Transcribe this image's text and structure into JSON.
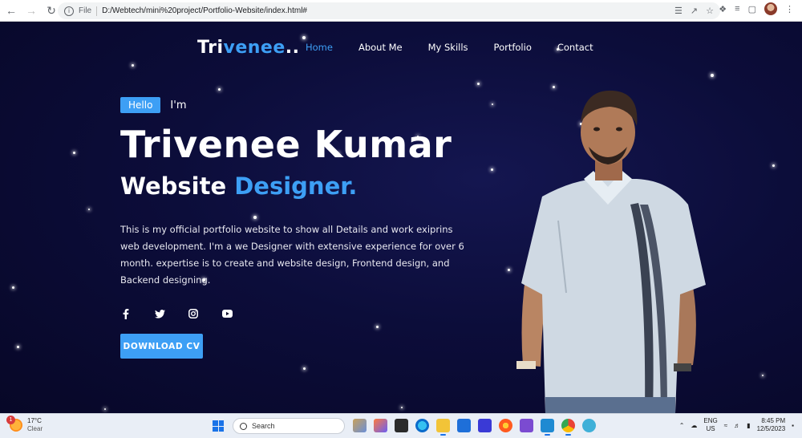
{
  "browser": {
    "scheme_label": "File",
    "url": "D:/Webtech/mini%20project/Portfolio-Website/index.html#"
  },
  "nav": {
    "logo_main": "Tri",
    "logo_accent": "venee",
    "logo_tail": "..",
    "items": [
      {
        "label": "Home",
        "active": true
      },
      {
        "label": "About Me",
        "active": false
      },
      {
        "label": "My Skills",
        "active": false
      },
      {
        "label": "Portfolio",
        "active": false
      },
      {
        "label": "Contact",
        "active": false
      }
    ]
  },
  "hero": {
    "hello": "Hello",
    "im": "I'm",
    "name": "Trivenee Kumar",
    "role_main": "Website ",
    "role_accent": "Designer.",
    "description": "This is my official portfolio website to show all Details and work exiprins web development. I'm a we Designer with extensive experience for over 6 month. expertise is to create and website design, Frontend design, and Backend designing.",
    "social": [
      "facebook-icon",
      "twitter-icon",
      "instagram-icon",
      "youtube-icon"
    ],
    "cta": "DOWNLOAD CV"
  },
  "colors": {
    "accent": "#3d9ff5",
    "background": "#0a0a2a"
  },
  "taskbar": {
    "weather_temp": "17°C",
    "weather_desc": "Clear",
    "weather_badge": "1",
    "search_placeholder": "Search",
    "lang_line1": "ENG",
    "lang_line2": "US",
    "time": "8:45 PM",
    "date": "12/5/2023"
  }
}
